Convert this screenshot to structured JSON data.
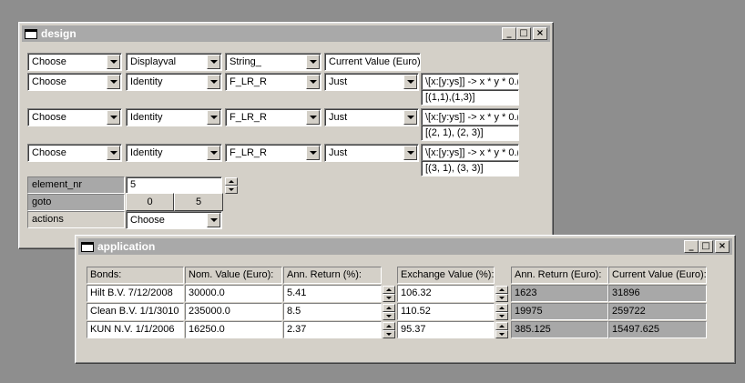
{
  "design": {
    "title": "design",
    "rows": [
      {
        "choose": "Choose",
        "fn": "Displayval",
        "op": "String_",
        "just": "Current Value (Euro):",
        "expr": "",
        "result": ""
      },
      {
        "choose": "Choose",
        "fn": "Identity",
        "op": "F_LR_R",
        "just": "Just",
        "expr": "\\[x:[y:ys]] -> x * y  * 0.(",
        "result": "[(1,1),(1,3)]"
      },
      {
        "choose": "Choose",
        "fn": "Identity",
        "op": "F_LR_R",
        "just": "Just",
        "expr": "\\[x:[y:ys]] -> x * y  * 0.(",
        "result": "[(2, 1), (2, 3)]"
      },
      {
        "choose": "Choose",
        "fn": "Identity",
        "op": "F_LR_R",
        "just": "Just",
        "expr": "\\[x:[y:ys]] -> x * y  * 0.(",
        "result": "[(3, 1), (3, 3)]"
      }
    ],
    "element_nr_label": "element_nr",
    "element_nr_value": "5",
    "goto_label": "goto",
    "goto_btn_0": "0",
    "goto_btn_5": "5",
    "actions_label": "actions",
    "actions_value": "Choose"
  },
  "application": {
    "title": "application",
    "headers": [
      "Bonds:",
      "Nom. Value (Euro):",
      "Ann. Return (%):",
      "Exchange Value (%):",
      "Ann. Return (Euro):",
      "Current Value (Euro):"
    ],
    "rows": [
      {
        "bond": "Hilt B.V. 7/12/2008",
        "nom": "30000.0",
        "ret": "5.41",
        "exch": "106.32",
        "ann_euro": "1623",
        "cur": "31896"
      },
      {
        "bond": "Clean B.V. 1/1/3010",
        "nom": "235000.0",
        "ret": "8.5",
        "exch": "110.52",
        "ann_euro": "19975",
        "cur": "259722"
      },
      {
        "bond": "KUN N.V. 1/1/2006",
        "nom": "16250.0",
        "ret": "2.37",
        "exch": "95.37",
        "ann_euro": "385.125",
        "cur": "15497.625"
      }
    ]
  },
  "window_buttons": {
    "minimize": "_",
    "maximize": "□",
    "close": "×"
  }
}
